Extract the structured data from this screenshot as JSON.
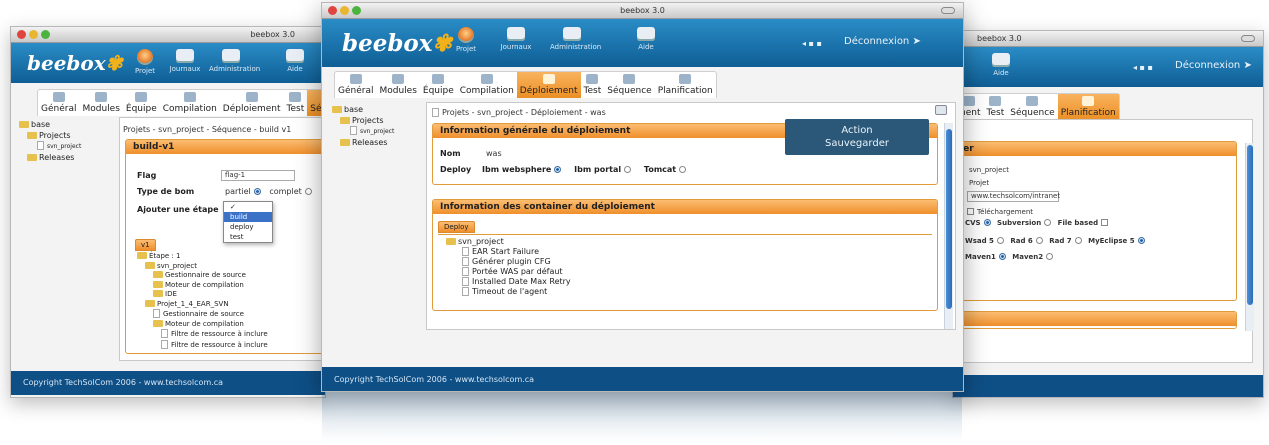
{
  "brand": "beebox",
  "footer": "Copyright TechSolCom 2006 - www.techsolcom.ca",
  "main": {
    "window_title": "beebox 3.0",
    "toolbar": [
      "Projet",
      "Journaux",
      "Administration",
      "Aide"
    ],
    "nav_icons": "◂ ▪ ▪",
    "logout": "Déconnexion ➤",
    "tabs": [
      "Général",
      "Modules",
      "Équipe",
      "Compilation",
      "Déploiement",
      "Test",
      "Séquence",
      "Planification"
    ],
    "tree": {
      "root": "base",
      "projects": "Projects",
      "project": "svn_project",
      "releases": "Releases"
    },
    "breadcrumb": "Projets - svn_project - Déploiement - was",
    "tooltip": {
      "line1": "Action",
      "line2": "Sauvegarder"
    },
    "general_box": {
      "title": "Information générale du déploiement",
      "nom_label": "Nom",
      "nom_value": "was",
      "deploy_label": "Deploy",
      "options": [
        "Ibm websphere",
        "Ibm portal",
        "Tomcat"
      ]
    },
    "container_box": {
      "title": "Information des container du déploiement",
      "subtab": "Deploy",
      "root": "svn_project",
      "items": [
        "EAR Start Failure",
        "Générer plugin CFG",
        "Portée WAS par défaut",
        "Installed Date Max Retry",
        "Timeout de l'agent"
      ]
    }
  },
  "left": {
    "window_title": "beebox 3.0",
    "toolbar": [
      "Projet",
      "Journaux",
      "Administration",
      "Aide"
    ],
    "tabs": [
      "Général",
      "Modules",
      "Équipe",
      "Compilation",
      "Déploiement",
      "Test",
      "Séquence"
    ],
    "tree": {
      "root": "base",
      "projects": "Projects",
      "project": "svn_project",
      "releases": "Releases"
    },
    "breadcrumb": "Projets - svn_project - Séquence - build v1",
    "box_title": "build-v1",
    "flag_label": "Flag",
    "flag_value": "flag-1",
    "type_label": "Type de bom",
    "type_options": [
      "partiel",
      "complet"
    ],
    "step_label": "Ajouter une étape",
    "dropdown": [
      "✓",
      "build",
      "deploy",
      "test"
    ],
    "subtab": "v1",
    "steps": [
      "Étape : 1",
      "svn_project",
      "Gestionnaire de source",
      "Moteur de compilation",
      "IDE",
      "Projet_1_4_EAR_SVN",
      "Gestionnaire de source",
      "Moteur de compilation",
      "Filtre de ressource à inclure",
      "Filtre de ressource à inclure"
    ]
  },
  "right": {
    "window_title": "beebox 3.0",
    "toolbar": [
      "Aide"
    ],
    "nav_icons": "◂ ▪ ▪",
    "logout": "Déconnexion ➤",
    "tabs": [
      "ment",
      "Test",
      "Séquence",
      "Planification"
    ],
    "box_title": "ler",
    "project_value": "svn_project",
    "projet_value": "Projet",
    "url_value": "www.techsolcom/intranet",
    "download_label": "Téléchargement",
    "scm": [
      "CVS",
      "Subversion",
      "File based"
    ],
    "ide": [
      "Wsad 5",
      "Rad 6",
      "Rad 7",
      "MyEclipse 5"
    ],
    "build": [
      "Maven1",
      "Maven2"
    ]
  }
}
